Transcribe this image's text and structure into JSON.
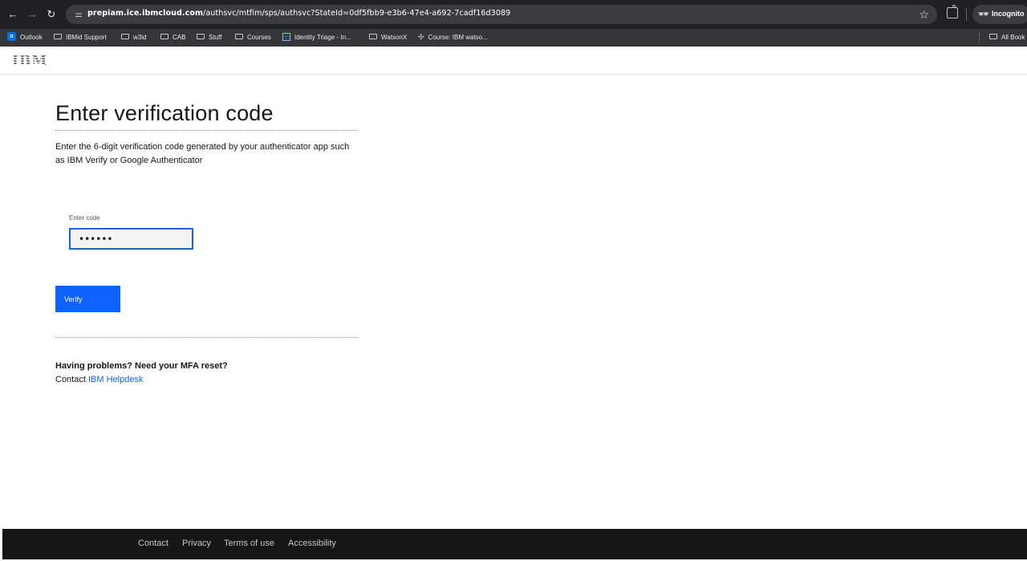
{
  "browser": {
    "url_host": "prepiam.ice.ibmcloud.com",
    "url_path": "/authsvc/mtfim/sps/authsvc?StateId=0df5fbb9-e3b6-47e4-a692-7cadf16d3089",
    "incognito_label": "Incognito",
    "bookmarks": [
      {
        "label": "Outlook",
        "icon": "outlook-icon"
      },
      {
        "label": "IBMid Support",
        "icon": "folder-icon"
      },
      {
        "label": "w3id",
        "icon": "folder-icon"
      },
      {
        "label": "CAB",
        "icon": "folder-icon"
      },
      {
        "label": "Stuff",
        "icon": "folder-icon"
      },
      {
        "label": "Courses",
        "icon": "folder-icon"
      },
      {
        "label": "Identity Triage - In...",
        "icon": "sheet-icon"
      },
      {
        "label": "WatsonX",
        "icon": "folder-icon"
      },
      {
        "label": "Course: IBM watso...",
        "icon": "course-icon"
      }
    ],
    "all_bookmarks_label": "All Book"
  },
  "header": {
    "logo_text": "IBM"
  },
  "main": {
    "title": "Enter verification code",
    "instructions": "Enter the 6-digit verification code generated by your authenticator app such as IBM Verify or Google Authenticator",
    "code_label": "Enter code",
    "code_value": "••••••",
    "verify_label": "Verify",
    "help_heading": "Having problems? Need your MFA reset?",
    "help_contact_prefix": "Contact",
    "help_link": "IBM Helpdesk"
  },
  "footer": {
    "links": [
      "Contact",
      "Privacy",
      "Terms of use",
      "Accessibility"
    ]
  },
  "colors": {
    "ibm_blue": "#0f62fe",
    "footer_bg": "#161616",
    "chrome_bg": "#202124"
  }
}
